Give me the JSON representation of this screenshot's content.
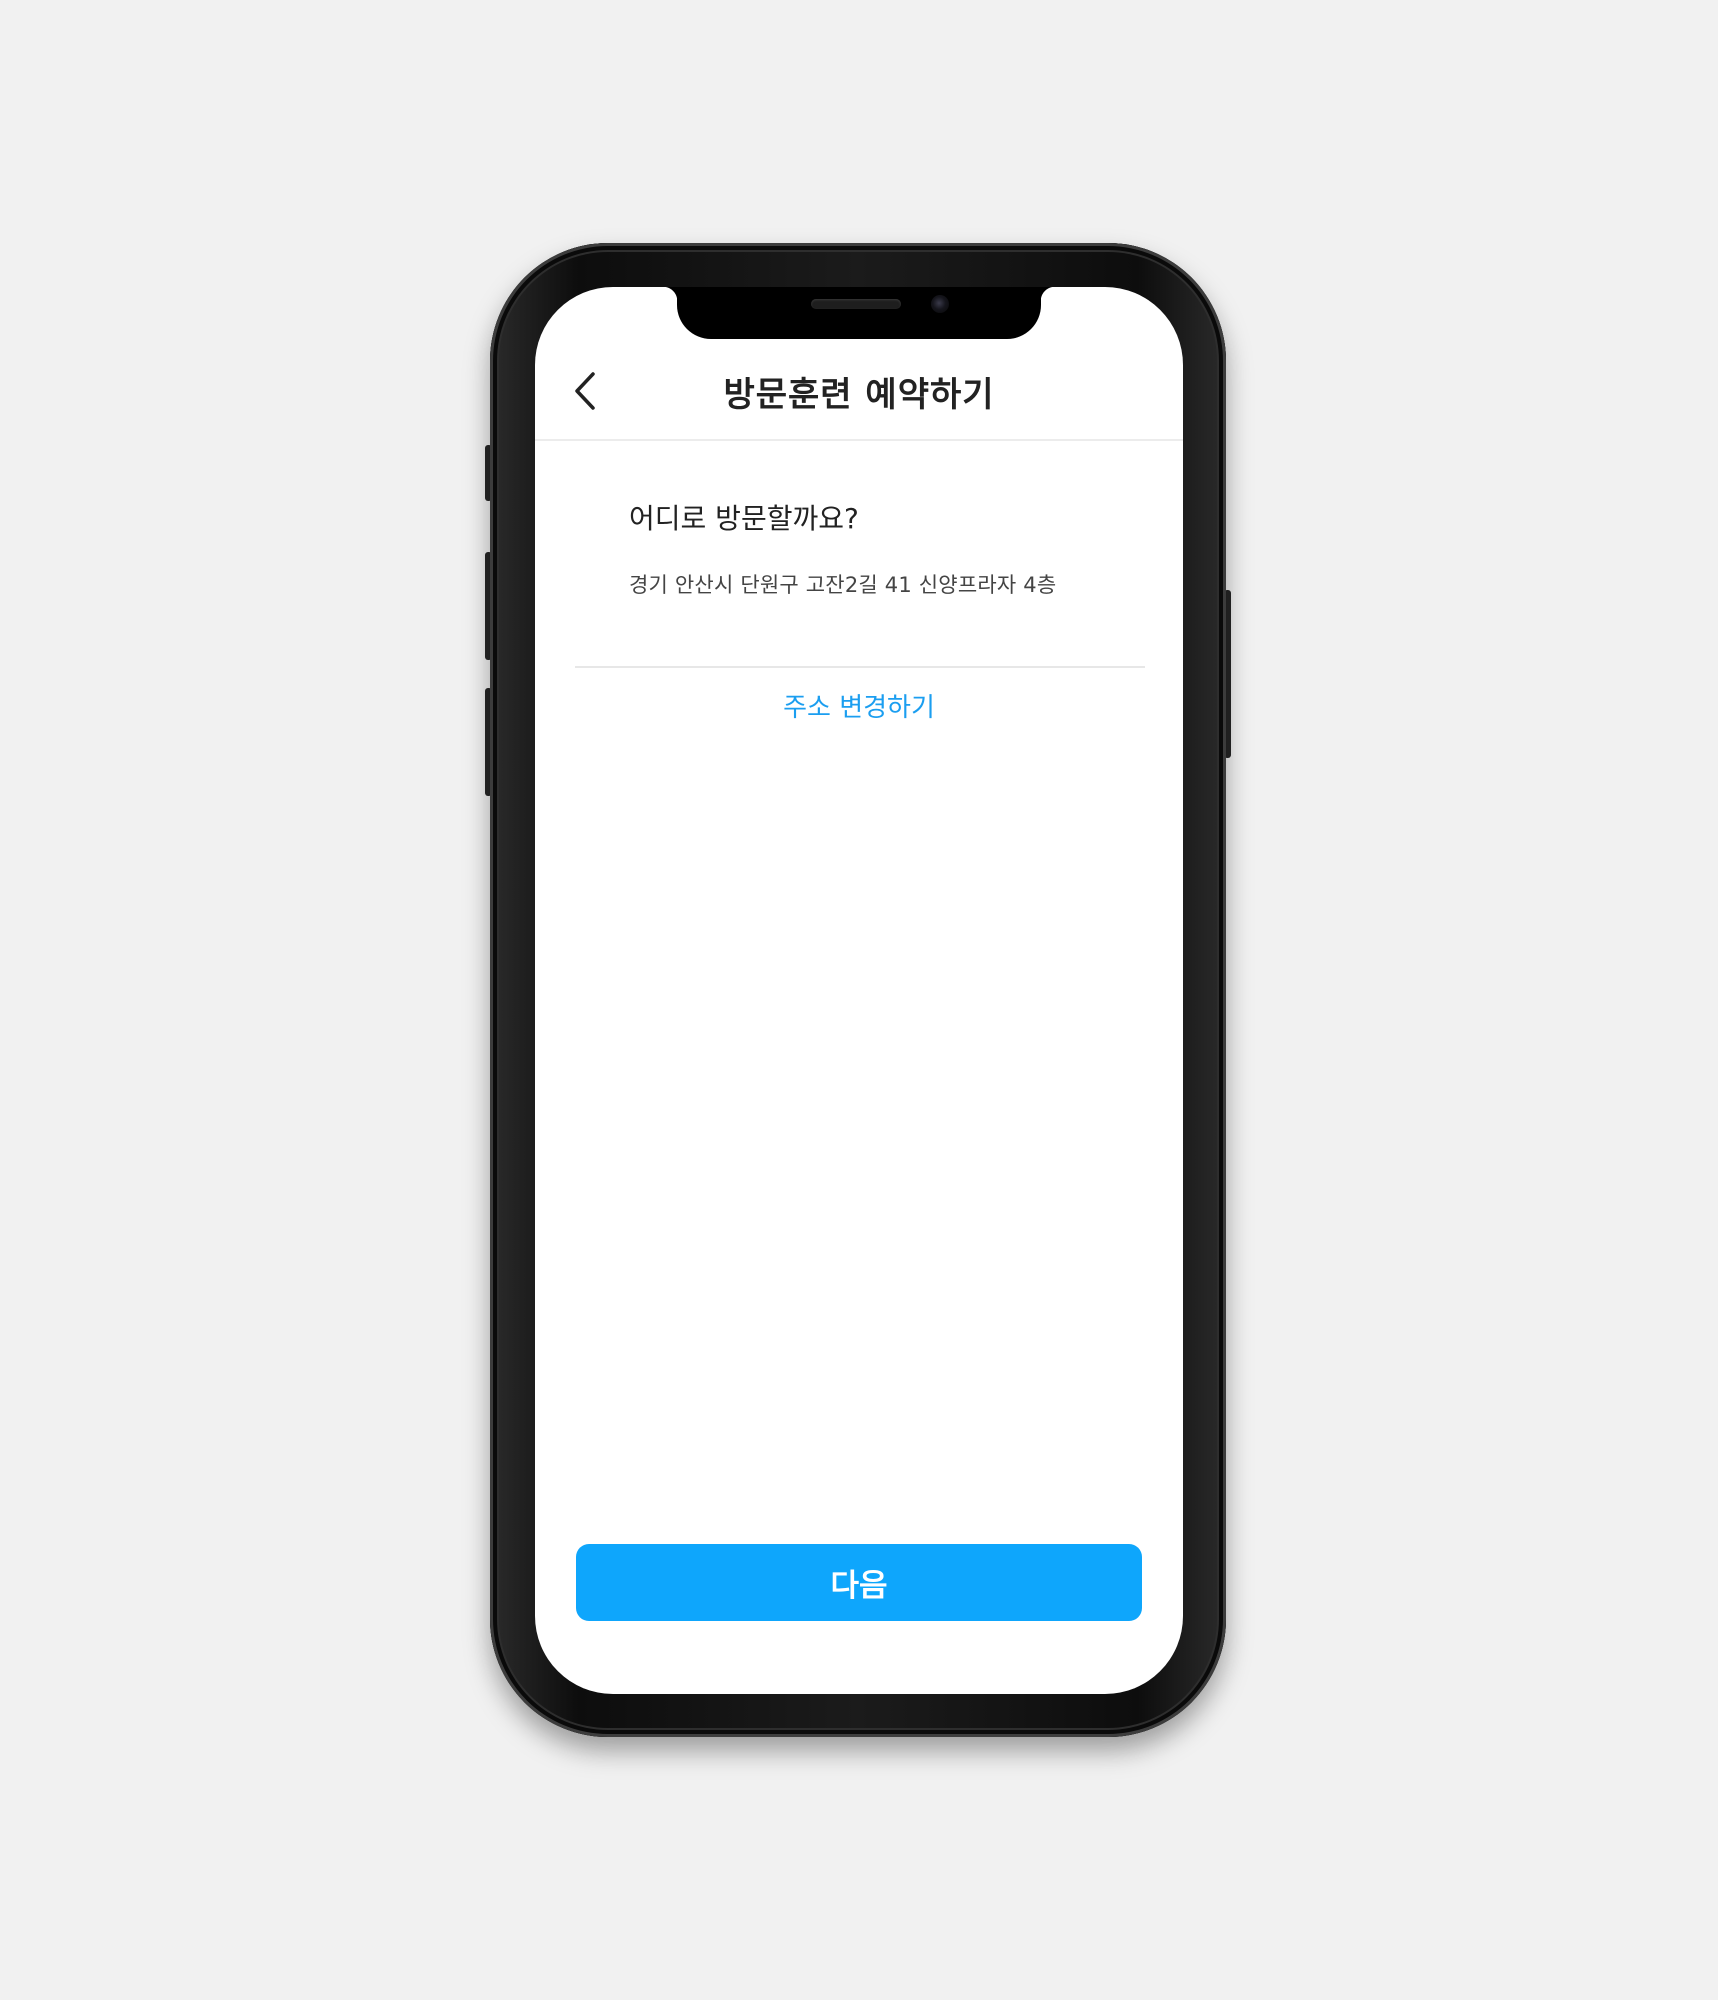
{
  "header": {
    "title": "방문훈련 예약하기",
    "back_icon": "chevron-left-icon"
  },
  "location": {
    "question": "어디로 방문할까요?",
    "address": "경기 안산시 단원구 고잔2길 41 신양프라자 4층",
    "change_label": "주소 변경하기"
  },
  "footer": {
    "next_label": "다음"
  },
  "colors": {
    "accent": "#0ea6fc",
    "link": "#1b9ef0",
    "background": "#f1f1f1"
  }
}
